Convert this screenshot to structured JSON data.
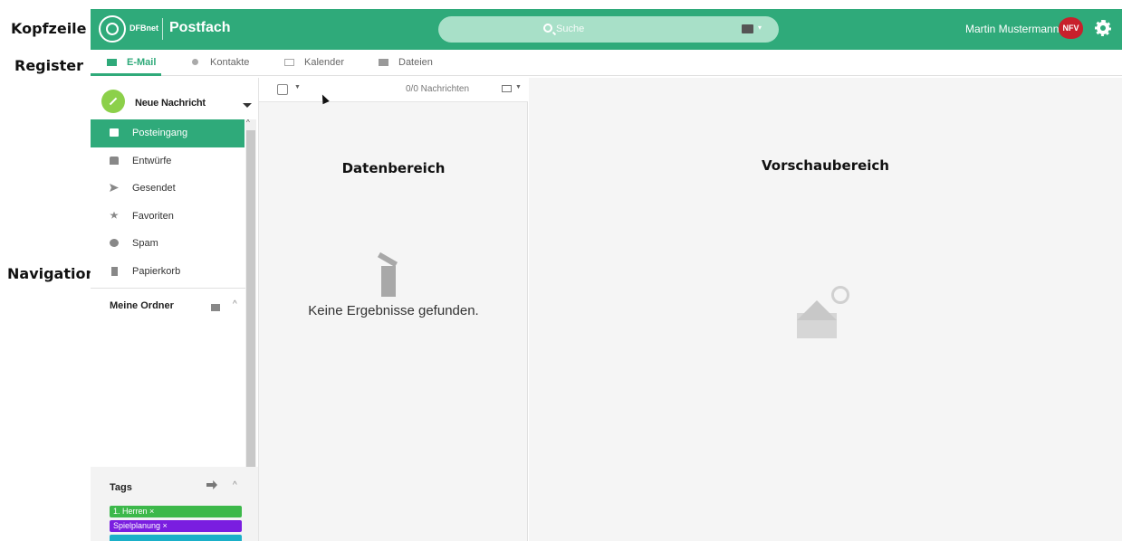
{
  "annotations": {
    "kopfzeile": "Kopfzeile",
    "register": "Register",
    "navigation": "Navigation"
  },
  "header": {
    "brand": "DFBnet",
    "app_title": "Postfach",
    "search_placeholder": "Suche",
    "user_name": "Martin Mustermann",
    "club_logo_text": "NFV",
    "accent_color": "#2faa7a"
  },
  "tabs": [
    {
      "label": "E-Mail",
      "icon": "envelope-icon",
      "active": true
    },
    {
      "label": "Kontakte",
      "icon": "person-icon",
      "active": false
    },
    {
      "label": "Kalender",
      "icon": "calendar-icon",
      "active": false
    },
    {
      "label": "Dateien",
      "icon": "briefcase-icon",
      "active": false
    }
  ],
  "sidebar": {
    "new_message": "Neue Nachricht",
    "folders": [
      {
        "label": "Posteingang",
        "icon": "inbox-icon",
        "active": true
      },
      {
        "label": "Entwürfe",
        "icon": "draft-icon",
        "active": false
      },
      {
        "label": "Gesendet",
        "icon": "send-icon",
        "active": false
      },
      {
        "label": "Favoriten",
        "icon": "star-icon",
        "active": false
      },
      {
        "label": "Spam",
        "icon": "spam-icon",
        "active": false
      },
      {
        "label": "Papierkorb",
        "icon": "trash-icon",
        "active": false
      }
    ],
    "my_folders": "Meine Ordner",
    "tags_title": "Tags",
    "tags": [
      {
        "label": "1. Herren",
        "color": "#3cb84a"
      },
      {
        "label": "Spielplanung",
        "color": "#7a1ee0"
      }
    ]
  },
  "data_pane": {
    "message_count": "0/0 Nachrichten",
    "section_label": "Datenbereich",
    "empty_text": "Keine Ergebnisse gefunden."
  },
  "preview": {
    "section_label": "Vorschaubereich"
  }
}
